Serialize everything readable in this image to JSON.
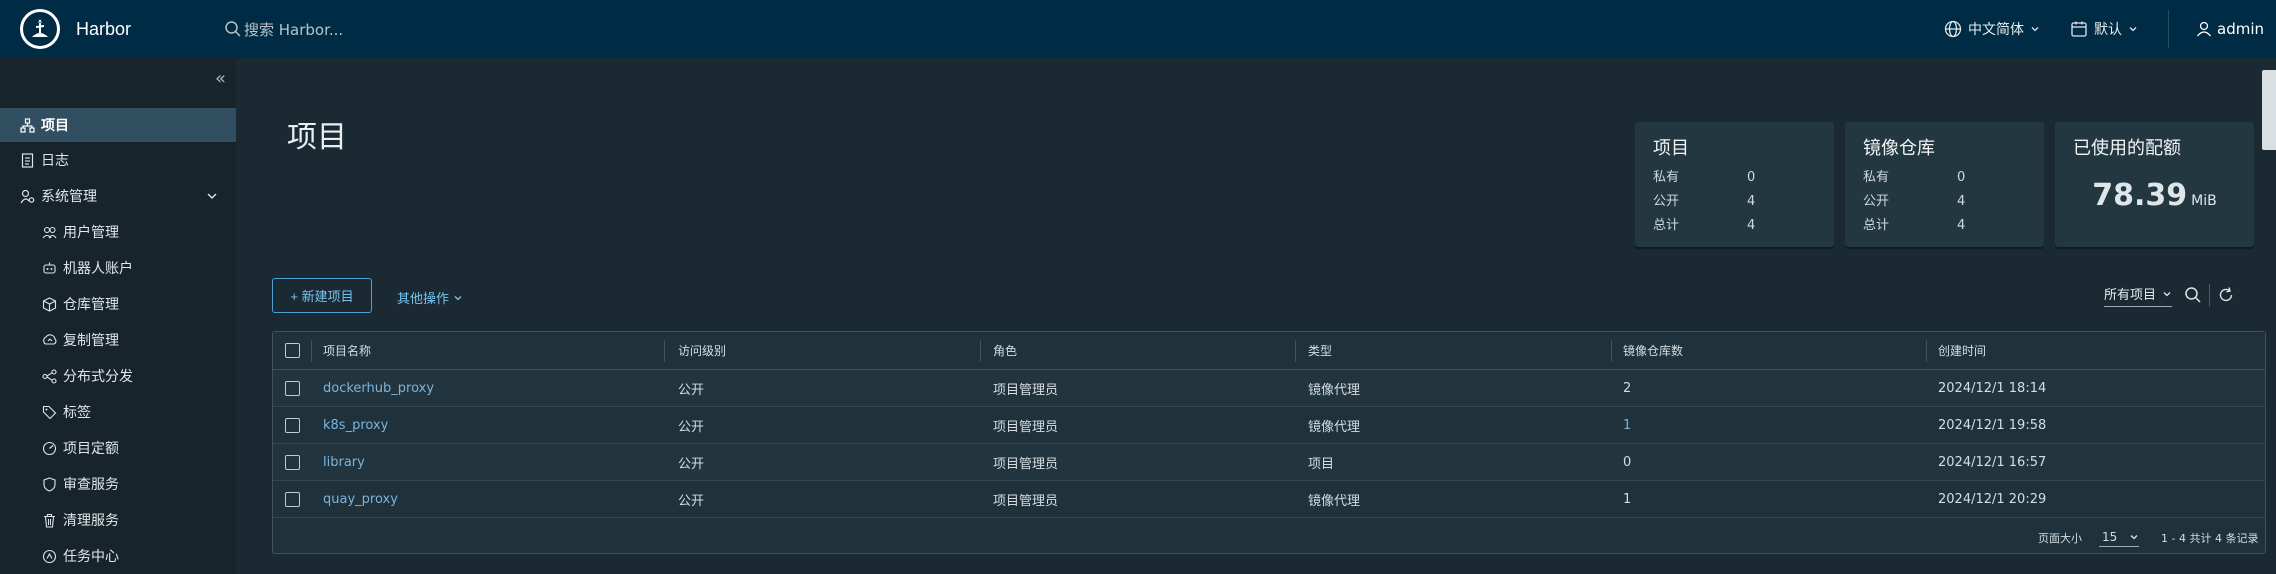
{
  "header": {
    "brand": "Harbor",
    "search_placeholder": "搜索 Harbor...",
    "language": "中文简体",
    "date_format": "默认",
    "user": "admin"
  },
  "sidebar": {
    "collapse_glyph": "«",
    "items": [
      {
        "label": "项目",
        "icon": "projects-icon",
        "active": true
      },
      {
        "label": "日志",
        "icon": "log-icon"
      },
      {
        "label": "系统管理",
        "icon": "admin-icon",
        "expandable": true
      },
      {
        "label": "用户管理",
        "icon": "users-icon"
      },
      {
        "label": "机器人账户",
        "icon": "robot-icon"
      },
      {
        "label": "仓库管理",
        "icon": "registry-icon"
      },
      {
        "label": "复制管理",
        "icon": "replication-icon"
      },
      {
        "label": "分布式分发",
        "icon": "distribution-icon"
      },
      {
        "label": "标签",
        "icon": "tag-icon"
      },
      {
        "label": "项目定额",
        "icon": "quota-icon"
      },
      {
        "label": "审查服务",
        "icon": "shield-icon"
      },
      {
        "label": "清理服务",
        "icon": "trash-icon"
      },
      {
        "label": "任务中心",
        "icon": "job-icon"
      }
    ]
  },
  "main": {
    "title": "项目",
    "cards": {
      "projects": {
        "title": "项目",
        "rows": [
          {
            "k": "私有",
            "v": "0"
          },
          {
            "k": "公开",
            "v": "4"
          },
          {
            "k": "总计",
            "v": "4"
          }
        ]
      },
      "repos": {
        "title": "镜像仓库",
        "rows": [
          {
            "k": "私有",
            "v": "0"
          },
          {
            "k": "公开",
            "v": "4"
          },
          {
            "k": "总计",
            "v": "4"
          }
        ]
      },
      "quota": {
        "title": "已使用的配额",
        "value": "78.39",
        "unit": "MiB"
      }
    },
    "new_project": "+ 新建项目",
    "more_ops": "其他操作",
    "filter": "所有项目",
    "table": {
      "columns": [
        "项目名称",
        "访问级别",
        "角色",
        "类型",
        "镜像仓库数",
        "创建时间"
      ],
      "rows": [
        [
          "dockerhub_proxy",
          "公开",
          "项目管理员",
          "镜像代理",
          "2",
          "2024/12/1 18:14"
        ],
        [
          "k8s_proxy",
          "公开",
          "项目管理员",
          "镜像代理",
          "1",
          "2024/12/1 19:58"
        ],
        [
          "library",
          "公开",
          "项目管理员",
          "项目",
          "0",
          "2024/12/1 16:57"
        ],
        [
          "quay_proxy",
          "公开",
          "项目管理员",
          "镜像代理",
          "1",
          "2024/12/1 20:29"
        ]
      ],
      "page_size_label": "页面大小",
      "page_size": "15",
      "count_text": "1 - 4 共计 4 条记录"
    }
  }
}
